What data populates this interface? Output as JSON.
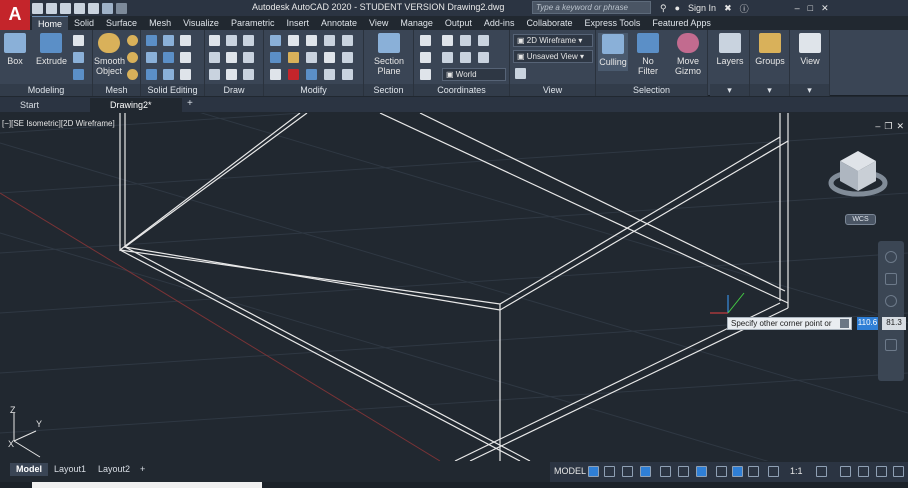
{
  "app": {
    "logo": "A",
    "title": "Autodesk AutoCAD 2020 - STUDENT VERSION    Drawing2.dwg",
    "search_placeholder": "Type a keyword or phrase",
    "sign_in": "Sign In"
  },
  "ribbon_tabs": [
    "Home",
    "Solid",
    "Surface",
    "Mesh",
    "Visualize",
    "Parametric",
    "Insert",
    "Annotate",
    "View",
    "Manage",
    "Output",
    "Add-ins",
    "Collaborate",
    "Express Tools",
    "Featured Apps"
  ],
  "ribbon": {
    "modeling": {
      "title": "Modeling",
      "box": "Box",
      "extrude": "Extrude"
    },
    "mesh": {
      "title": "Mesh",
      "smooth1": "Smooth",
      "smooth2": "Object"
    },
    "solid_editing": {
      "title": "Solid Editing"
    },
    "draw": {
      "title": "Draw"
    },
    "modify": {
      "title": "Modify"
    },
    "section": {
      "title": "Section",
      "btn1": "Section",
      "btn2": "Plane"
    },
    "coordinates": {
      "title": "Coordinates",
      "ucs": "World"
    },
    "view": {
      "title": "View",
      "style": "2D Wireframe",
      "saved": "Unsaved View"
    },
    "selection": {
      "title": "Selection",
      "culling": "Culling",
      "nofilter": "No Filter",
      "move1": "Move",
      "move2": "Gizmo"
    },
    "layers": "Layers",
    "groups": "Groups",
    "view_btn": "View"
  },
  "doc_tabs": [
    "Start",
    "Drawing2*"
  ],
  "viewport": {
    "label": "[−][SE Isometric][2D Wireframe]",
    "wcs": "WCS",
    "tooltip": "Specify other corner point or",
    "dyn_value1": "110.6",
    "dyn_value2": "81.3"
  },
  "layout_tabs": [
    "Model",
    "Layout1",
    "Layout2"
  ],
  "status": {
    "model": "MODEL",
    "scale": "1:1"
  },
  "icons": [
    "app-logo",
    "new-icon",
    "open-icon",
    "save-icon",
    "undo-icon",
    "redo-icon",
    "search-icon",
    "user-icon",
    "cart-icon",
    "help-icon",
    "minimize-icon",
    "maximize-icon",
    "close-icon",
    "ucs-icon",
    "viewcube-icon"
  ]
}
